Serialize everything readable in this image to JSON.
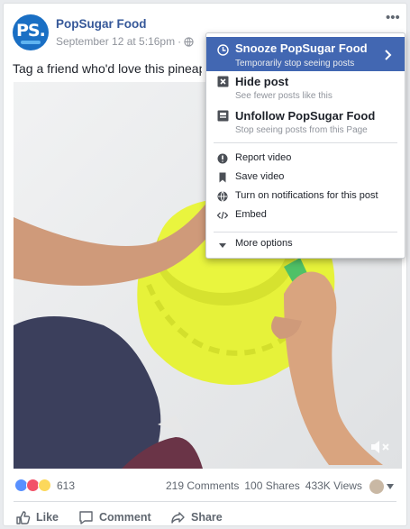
{
  "post": {
    "page_name": "PopSugar Food",
    "avatar_text": "PS.",
    "timestamp": "September 12 at 5:16pm",
    "meta_separator": "·",
    "more_label": "•••",
    "caption": "Tag a friend who'd love this pineapple"
  },
  "engagement": {
    "reaction_count": "613",
    "comments": "219 Comments",
    "shares": "100 Shares",
    "views": "433K Views"
  },
  "actions": {
    "like": "Like",
    "comment": "Comment",
    "share": "Share"
  },
  "menu": {
    "snooze": {
      "title": "Snooze PopSugar Food",
      "subtitle": "Temporarily stop seeing posts"
    },
    "hide": {
      "title": "Hide post",
      "subtitle": "See fewer posts like this"
    },
    "unfollow": {
      "title": "Unfollow PopSugar Food",
      "subtitle": "Stop seeing posts from this Page"
    },
    "report_video": "Report video",
    "save_video": "Save video",
    "notifications": "Turn on notifications for this post",
    "embed": "Embed",
    "more_options": "More options"
  },
  "colors": {
    "brand_blue": "#4267b2",
    "link_blue": "#365899",
    "muted_text": "#90949c",
    "plate_yellow": "#e8f53a"
  },
  "icons": {
    "snooze": "clock-icon",
    "hide": "x-box-icon",
    "unfollow": "unfollow-icon",
    "report": "alert-icon",
    "save": "bookmark-icon",
    "notify": "globe-icon",
    "embed": "code-icon",
    "more": "caret-down-icon"
  }
}
